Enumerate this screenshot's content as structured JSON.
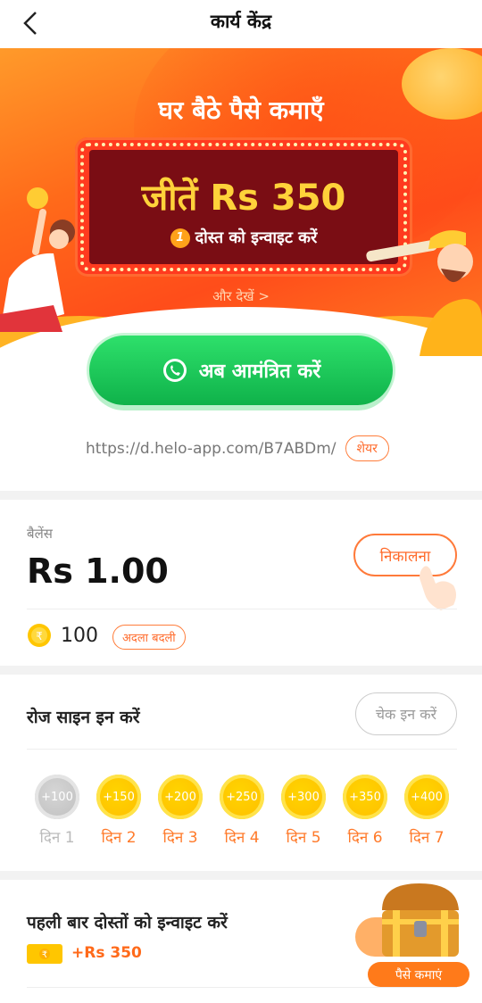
{
  "header": {
    "title": "कार्य केंद्र",
    "back_icon": "chevron-left-icon"
  },
  "banner": {
    "headline": "घर बैठे पैसे कमाएँ",
    "prize_title": "जीतें Rs 350",
    "prize_badge": "1",
    "prize_subtitle": "दोस्त को इन्वाइट करें",
    "more_link": "और देखें  >"
  },
  "invite": {
    "button_label": "अब आमंत्रित करें",
    "icon": "whatsapp-icon"
  },
  "share": {
    "link": "https://d.helo-app.com/B7ABDm/",
    "share_label": "शेयर"
  },
  "balance": {
    "label": "बैलेंस",
    "value": "Rs 1.00",
    "withdraw_label": "निकालना",
    "coins": "100",
    "exchange_label": "अदला बदली"
  },
  "checkin": {
    "title": "रोज साइन इन करें",
    "button_label": "चेक इन करें",
    "days": [
      {
        "amount": "+100",
        "label": "दिन 1",
        "done": true
      },
      {
        "amount": "+150",
        "label": "दिन 2",
        "done": false
      },
      {
        "amount": "+200",
        "label": "दिन 3",
        "done": false
      },
      {
        "amount": "+250",
        "label": "दिन 4",
        "done": false
      },
      {
        "amount": "+300",
        "label": "दिन 5",
        "done": false
      },
      {
        "amount": "+350",
        "label": "दिन 6",
        "done": false
      },
      {
        "amount": "+400",
        "label": "दिन 7",
        "done": false
      }
    ]
  },
  "first_invite": {
    "title": "पहली बार दोस्तों को इन्वाइट करें",
    "reward": "+Rs 350",
    "earn_label": "पैसे कमाएं"
  },
  "colors": {
    "accent": "#ff6a1a",
    "green": "#19c257",
    "gold": "#ffc600"
  }
}
